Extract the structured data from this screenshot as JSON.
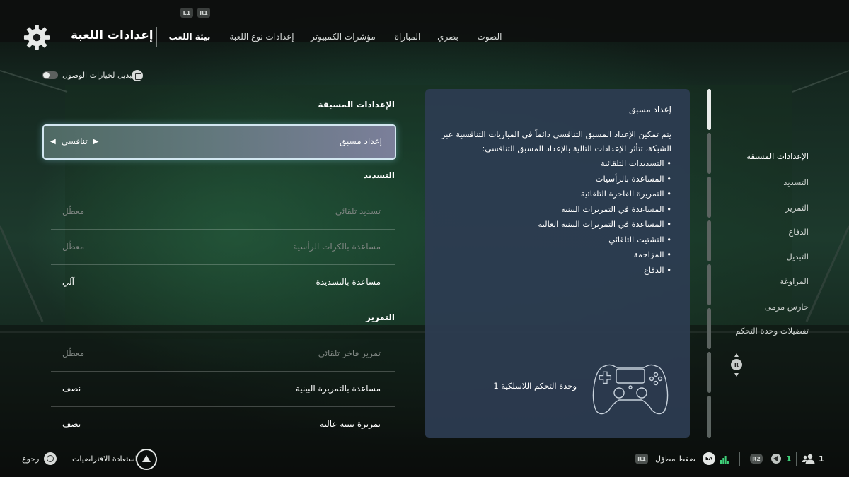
{
  "header": {
    "bumpers": {
      "l1": "L1",
      "r1": "R1"
    },
    "title": "إعدادات اللعبة",
    "tabs": [
      {
        "label": "بيئة اللعب",
        "active": true
      },
      {
        "label": "إعدادات نوع اللعبة",
        "active": false
      },
      {
        "label": "مؤشرات الكمبيوتر",
        "active": false
      },
      {
        "label": "المباراة",
        "active": false
      },
      {
        "label": "بصري",
        "active": false
      },
      {
        "label": "الصوت",
        "active": false
      }
    ]
  },
  "accessibility": {
    "label": "تبديل لخيارات الوصول",
    "enabled": false
  },
  "settings": {
    "presets": {
      "heading": "الإعدادات المسبقة",
      "row": {
        "label": "إعداد مسبق",
        "value": "تنافسي",
        "selected": true
      }
    },
    "shooting": {
      "heading": "التسديد",
      "rows": [
        {
          "label": "تسديد تلقائي",
          "value": "معطّل",
          "dimmed": true
        },
        {
          "label": "مساعدة بالكرات الرأسية",
          "value": "معطّل",
          "dimmed": true
        },
        {
          "label": "مساعدة بالتسديدة",
          "value": "آلي",
          "dimmed": false
        }
      ]
    },
    "passing": {
      "heading": "التمرير",
      "rows": [
        {
          "label": "تمرير فاخر تلقائي",
          "value": "معطّل",
          "dimmed": true
        },
        {
          "label": "مساعدة بالتمريرة البينية",
          "value": "نصف",
          "dimmed": false
        },
        {
          "label": "تمريرة بينية عالية",
          "value": "نصف",
          "dimmed": false
        }
      ]
    }
  },
  "info_panel": {
    "title": "إعداد مسبق",
    "body": "يتم تمكين الإعداد المسبق التنافسي دائماً في المباريات التنافسية عبر الشبكة، تتأثر الإعدادات التالية بالإعداد المسبق التنافسي:",
    "items": [
      "التسديدات التلقائية",
      "المساعدة بالرأسيات",
      "التمريرة الفاخرة التلقائية",
      "المساعدة في التمريرات البينية",
      "المساعدة في التمريرات البينية العالية",
      "التشتيت التلقائي",
      "المزاحمة",
      "الدفاع"
    ],
    "controller_label": "وحدة التحكم اللاسلكية 1"
  },
  "side_nav": {
    "items": [
      {
        "label": "الإعدادات المسبقة",
        "active": true
      },
      {
        "label": "التسديد",
        "active": false
      },
      {
        "label": "التمرير",
        "active": false
      },
      {
        "label": "الدفاع",
        "active": false
      },
      {
        "label": "التبديل",
        "active": false
      },
      {
        "label": "المراوغة",
        "active": false
      },
      {
        "label": "حارس مرمى",
        "active": false
      },
      {
        "label": "تفضيلات وحدة التحكم",
        "active": false
      }
    ],
    "stick_label": "R"
  },
  "footer": {
    "back_label": "رجوع",
    "restore_label": "استعادة الافتراضيات",
    "r1_chip": "R1",
    "press_hold_label": "ضغط مطوّل",
    "ea_label": "EA",
    "r2_chip": "R2",
    "volume_count": "1",
    "users_count": "1"
  },
  "colors": {
    "background_green": "#1d3a2d",
    "info_panel": "#2d3c52",
    "selected_row_border": "#d3e7f1",
    "dimmed_text": "#7e8581",
    "volume_green": "#3fd17a"
  }
}
